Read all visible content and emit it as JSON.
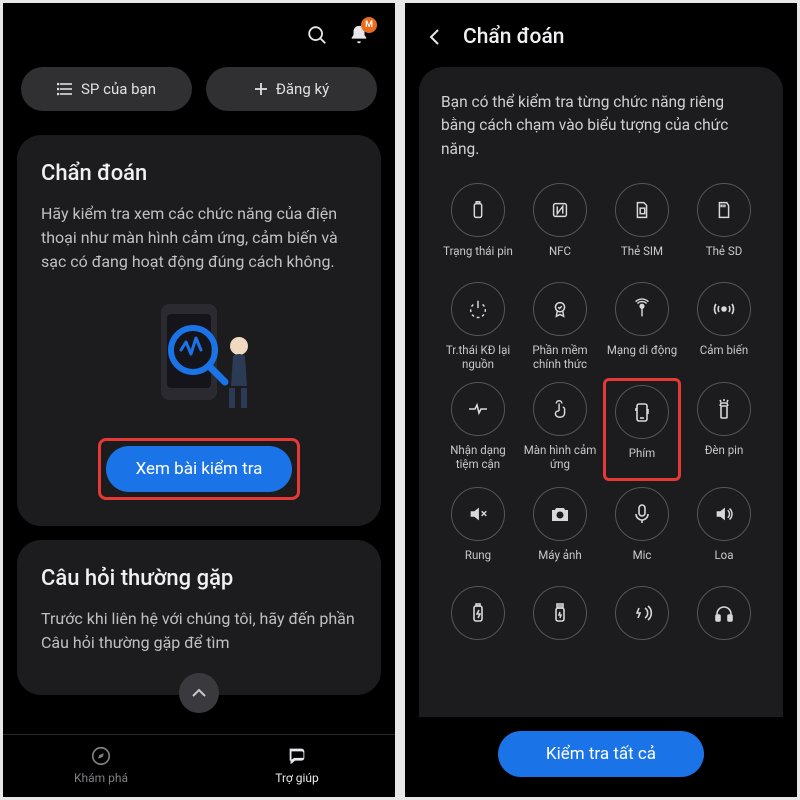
{
  "left": {
    "topbar": {
      "search": "search",
      "bell": "notifications",
      "badge": "M"
    },
    "pills": {
      "yourSp": "SP của bạn",
      "register": "Đăng ký"
    },
    "diag": {
      "title": "Chẩn đoán",
      "body": "Hãy kiểm tra xem các chức năng của điện thoại như màn hình cảm ứng, cảm biến và sạc có đang hoạt động đúng cách không.",
      "cta": "Xem bài kiểm tra"
    },
    "faq": {
      "title": "Câu hỏi thường gặp",
      "body": "Trước khi liên hệ với chúng tôi, hãy đến phần Câu hỏi thường gặp để tìm"
    },
    "nav": {
      "explore": "Khám phá",
      "help": "Trợ giúp"
    }
  },
  "right": {
    "title": "Chẩn đoán",
    "intro": "Bạn có thể kiểm tra từng chức năng riêng bằng cách chạm vào biểu tượng của chức năng.",
    "items": [
      {
        "label": "Trạng thái pin"
      },
      {
        "label": "NFC"
      },
      {
        "label": "Thẻ SIM"
      },
      {
        "label": "Thẻ SD"
      },
      {
        "label": "Tr.thái KĐ lại nguồn"
      },
      {
        "label": "Phần mềm chính thức"
      },
      {
        "label": "Mạng di động"
      },
      {
        "label": "Cảm biến"
      },
      {
        "label": "Nhận dạng tiệm cận"
      },
      {
        "label": "Màn hình cảm ứng"
      },
      {
        "label": "Phím"
      },
      {
        "label": "Đèn pin"
      },
      {
        "label": "Rung"
      },
      {
        "label": "Máy ảnh"
      },
      {
        "label": "Mic"
      },
      {
        "label": "Loa"
      },
      {
        "label": ""
      },
      {
        "label": ""
      },
      {
        "label": ""
      },
      {
        "label": ""
      }
    ],
    "cta": "Kiểm tra tất cả"
  }
}
